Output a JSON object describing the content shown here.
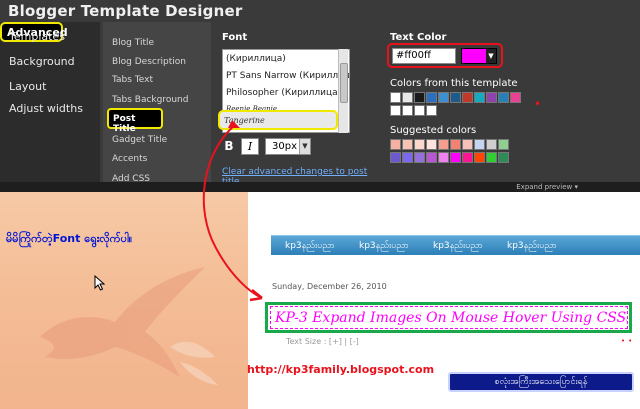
{
  "app": {
    "title": "Blogger Template Designer"
  },
  "nav": {
    "templates": "Templates",
    "background": "Background",
    "layout": "Layout",
    "adjust_widths": "Adjust widths",
    "advanced": "Advanced"
  },
  "subnav": {
    "blog_title": "Blog Title",
    "blog_description": "Blog Description",
    "tabs_text": "Tabs Text",
    "tabs_background": "Tabs Background",
    "post_title": "Post Title",
    "gadget_title": "Gadget Title",
    "accents": "Accents",
    "add_css": "Add CSS"
  },
  "font_panel": {
    "heading": "Font",
    "options": [
      "(Кириллица)",
      "PT Sans Narrow (Кириллица)",
      "Philosopher (Кириллица)",
      "Reenie Beanie",
      "Tangerine"
    ],
    "bold_label": "B",
    "italic_label": "I",
    "size": "30px",
    "clear_link": "Clear advanced changes to post title"
  },
  "color_panel": {
    "heading": "Text Color",
    "value": "#ff00ff",
    "current_color": "#ff00ff",
    "template_heading": "Colors from this template",
    "suggested_heading": "Suggested colors",
    "template_colors": [
      [
        "#ffffff",
        "#e8e8e8",
        "#1a1a1a",
        "#2a6fc0",
        "#3d8fd0",
        "#1e5a8a",
        "#c0392b",
        "#15aabf",
        "#8e44ad",
        "#2980b9",
        "#e84393"
      ],
      [
        "#ffffff",
        "#ffffff",
        "#ffffff",
        "#ffffff"
      ]
    ],
    "suggested_colors": [
      [
        "#f4b0a0",
        "#f7c4b4",
        "#fbd7cb",
        "#fce4dc",
        "#f69f8e",
        "#f48270",
        "#f6c1b8",
        "#c6d4f2",
        "#cfcfcf",
        "#8fcf8f"
      ],
      [
        "#6a5acd",
        "#7b68ee",
        "#9370db",
        "#ba55d3",
        "#ee82ee",
        "#ff00ff",
        "#ff1493",
        "#ff4500",
        "#32cd32",
        "#2e8b57"
      ]
    ]
  },
  "expand_bar": {
    "label": "Expand preview"
  },
  "preview": {
    "caption": "မိမိကြိုက်တဲ့Font ရွေးလိုက်ပါ။",
    "nav_links": [
      "kp3နည်းပညာ",
      "kp3နည်းပညာ",
      "kp3နည်းပညာ",
      "kp3နည်းပညာ"
    ],
    "date": "Sunday, December 26, 2010",
    "post_title": "KP-3 Expand Images On Mouse Hover Using CSS3",
    "text_size": "Text Size : [+] | [-]",
    "url": "http://kp3family.blogspot.com",
    "badge": "စလုံးအကြီးအသေးပြောင်းရန်"
  },
  "accent_colors": {
    "highlight_yellow": "#f1e800",
    "highlight_red": "#e8121c",
    "highlight_green": "#19a84a"
  }
}
